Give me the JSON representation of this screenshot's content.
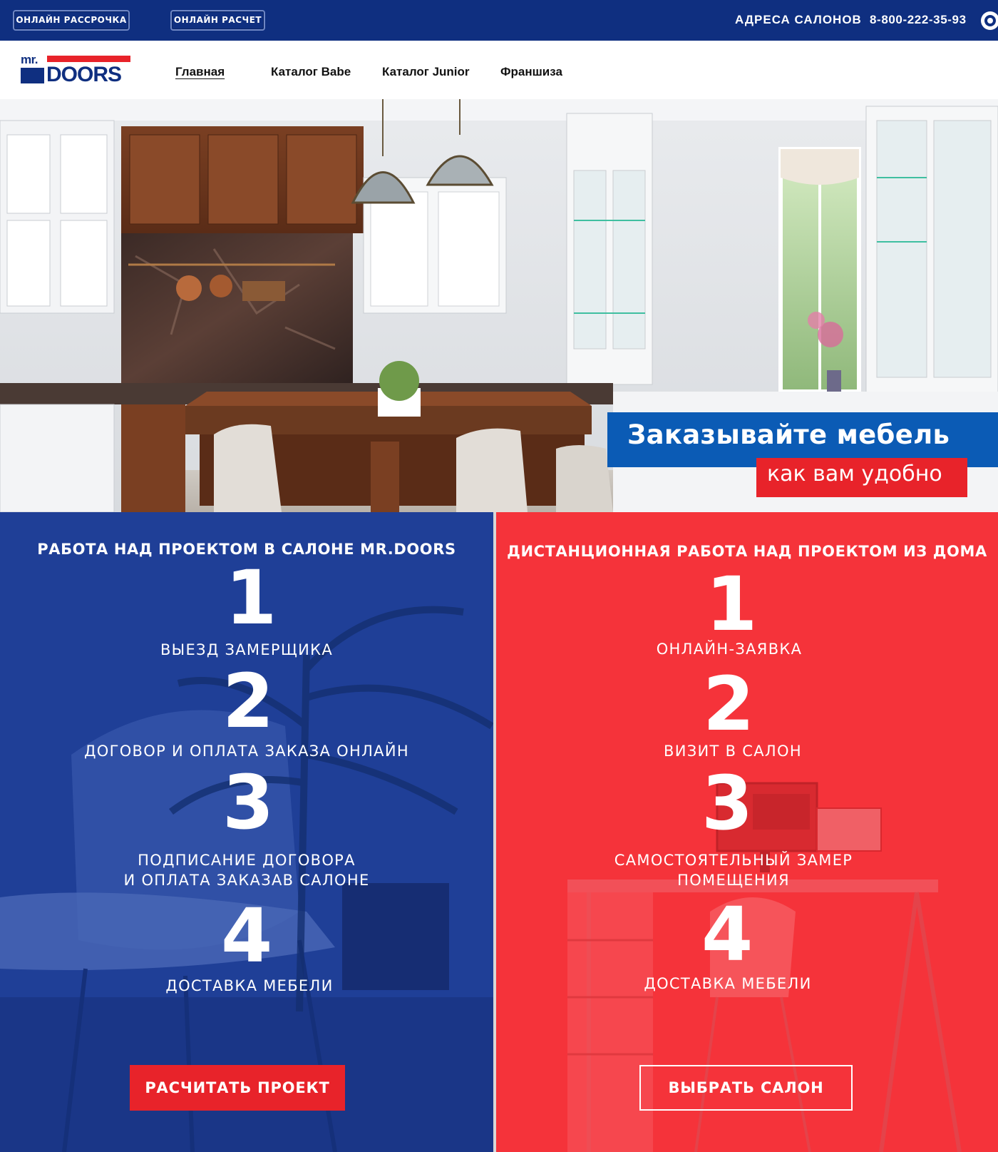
{
  "topbar": {
    "installment_label": "ОНЛАЙН РАССРОЧКА",
    "calc_label": "ОНЛАЙН РАСЧЕТ",
    "addresses_label": "АДРЕСА САЛОНОВ",
    "phone": "8-800-222-35-93"
  },
  "logo": {
    "mr": "mr.",
    "doors": "DOORS"
  },
  "nav": {
    "items": [
      {
        "label": "Главная",
        "active": true
      },
      {
        "label": "Каталог Babe",
        "active": false
      },
      {
        "label": "Каталог Junior",
        "active": false
      },
      {
        "label": "Франшиза",
        "active": false
      }
    ]
  },
  "hero": {
    "headline": "Заказывайте мебель",
    "subline": "как вам удобно"
  },
  "salon": {
    "title": "РАБОТА НАД ПРОЕКТОМ В САЛОНЕ MR.DOORS",
    "steps": [
      {
        "num": "1",
        "label": "ВЫЕЗД ЗАМЕРЩИКА"
      },
      {
        "num": "2",
        "label": "ДОГОВОР И ОПЛАТА ЗАКАЗА ОНЛАЙН"
      },
      {
        "num": "3",
        "label_line1": "ПОДПИСАНИЕ ДОГОВОРА",
        "label_line2": "И ОПЛАТА ЗАКАЗАВ САЛОНЕ"
      },
      {
        "num": "4",
        "label": "ДОСТАВКА МЕБЕЛИ"
      }
    ],
    "button": "РАСЧИТАТЬ ПРОЕКТ"
  },
  "remote": {
    "title": "ДИСТАНЦИОННАЯ РАБОТА НАД ПРОЕКТОМ ИЗ ДОМА",
    "steps": [
      {
        "num": "1",
        "label": "ОНЛАЙН-ЗАЯВКА"
      },
      {
        "num": "2",
        "label": "ВИЗИТ В САЛОН"
      },
      {
        "num": "3",
        "label_line1": "САМОСТОЯТЕЛЬНЫЙ ЗАМЕР",
        "label_line2": "ПОМЕЩЕНИЯ"
      },
      {
        "num": "4",
        "label": "ДОСТАВКА МЕБЕЛИ"
      }
    ],
    "button": "ВЫБРАТЬ САЛОН"
  },
  "colors": {
    "brand_blue": "#0f2f80",
    "panel_blue": "#1f3f97",
    "brand_red": "#e8232a",
    "panel_red": "#f5333a",
    "banner_blue": "#0b5bb5"
  }
}
